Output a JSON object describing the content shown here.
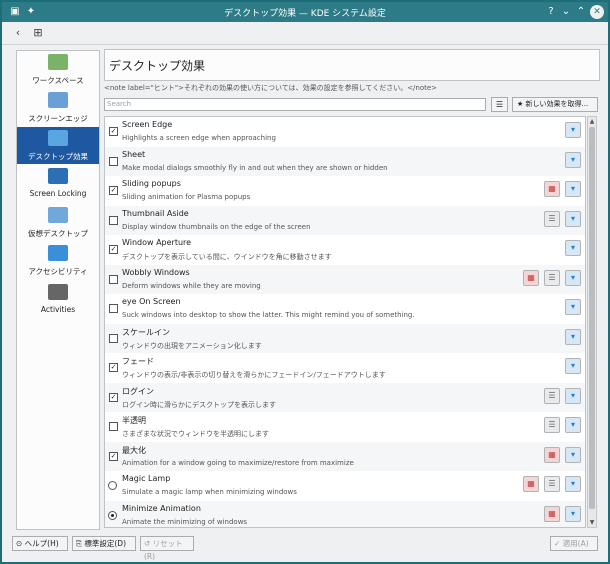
{
  "window": {
    "title": "デスクトップ効果 — KDE システム設定"
  },
  "titlebar": {
    "help_glyph": "?",
    "min_glyph": "⌄",
    "max_glyph": "⌃",
    "close_glyph": "✕"
  },
  "toolbar": {
    "back_glyph": "‹",
    "overview_glyph": "⊞"
  },
  "sidebar": {
    "items": [
      {
        "label": "ワークスペース",
        "icon": "workspace-icon",
        "color": "#7bb26a"
      },
      {
        "label": "スクリーンエッジ",
        "icon": "screen-edge-icon",
        "color": "#6aa0d6"
      },
      {
        "label": "デスクトップ効果",
        "icon": "desktop-effects-icon",
        "color": "#5aa6e0",
        "active": true
      },
      {
        "label": "Screen Locking",
        "icon": "screen-locking-icon",
        "color": "#2b6fb5"
      },
      {
        "label": "仮想デスクトップ",
        "icon": "virtual-desktop-icon",
        "color": "#6fa8d9"
      },
      {
        "label": "アクセシビリティ",
        "icon": "accessibility-icon",
        "color": "#3b8fd8"
      },
      {
        "label": "Activities",
        "icon": "activities-icon",
        "color": "#666666"
      }
    ]
  },
  "content": {
    "title": "デスクトップ効果",
    "note": "<note label=\"ヒント\">それぞれの効果の使い方については、効果の設定を参照してください。</note>",
    "search_placeholder": "Search",
    "config_glyph": "☰",
    "get_new_label": "★ 新しい効果を取得..."
  },
  "effects": [
    {
      "name": "Screen Edge",
      "desc": "Highlights a screen edge when approaching",
      "control": "checkbox",
      "checked": true,
      "video": false,
      "configure": false
    },
    {
      "name": "Sheet",
      "desc": "Make modal dialogs smoothly fly in and out when they are shown or hidden",
      "control": "checkbox",
      "checked": false,
      "video": false,
      "configure": false
    },
    {
      "name": "Sliding popups",
      "desc": "Sliding animation for Plasma popups",
      "control": "checkbox",
      "checked": true,
      "video": true,
      "configure": false
    },
    {
      "name": "Thumbnail Aside",
      "desc": "Display window thumbnails on the edge of the screen",
      "control": "checkbox",
      "checked": false,
      "video": false,
      "configure": true
    },
    {
      "name": "Window Aperture",
      "desc": "デスクトップを表示している間に、ウインドウを角に移動させます",
      "control": "checkbox",
      "checked": true,
      "video": false,
      "configure": false
    },
    {
      "name": "Wobbly Windows",
      "desc": "Deform windows while they are moving",
      "control": "checkbox",
      "checked": false,
      "video": true,
      "configure": true
    },
    {
      "name": "eye On Screen",
      "desc": "Suck windows into desktop to show the latter. This might remind you of something.",
      "control": "checkbox",
      "checked": false,
      "video": false,
      "configure": false
    },
    {
      "name": "スケールイン",
      "desc": "ウィンドウの出現をアニメーション化します",
      "control": "checkbox",
      "checked": false,
      "video": false,
      "configure": false
    },
    {
      "name": "フェード",
      "desc": "ウィンドウの表示/非表示の切り替えを滑らかにフェードイン/フェードアウトします",
      "control": "checkbox",
      "checked": true,
      "video": false,
      "configure": false
    },
    {
      "name": "ログイン",
      "desc": "ログイン時に滑らかにデスクトップを表示します",
      "control": "checkbox",
      "checked": true,
      "video": false,
      "configure": true
    },
    {
      "name": "半透明",
      "desc": "さまざまな状況でウィンドウを半透明にします",
      "control": "checkbox",
      "checked": false,
      "video": false,
      "configure": true
    },
    {
      "name": "最大化",
      "desc": "Animation for a window going to maximize/restore from maximize",
      "control": "checkbox",
      "checked": true,
      "video": true,
      "configure": false
    },
    {
      "name": "Magic Lamp",
      "desc": "Simulate a magic lamp when minimizing windows",
      "control": "radio",
      "checked": false,
      "video": true,
      "configure": true
    },
    {
      "name": "Minimize Animation",
      "desc": "Animate the minimizing of windows",
      "control": "radio",
      "checked": true,
      "video": true,
      "configure": false
    }
  ],
  "glyphs": {
    "check": "✓",
    "info": "▾",
    "video": "▦",
    "configure": "☰",
    "scroll_up": "▲",
    "scroll_down": "▼"
  },
  "bottom": {
    "help_label": "⊙ ヘルプ(H)",
    "defaults_label": "⎘ 標準設定(D)",
    "reset_label": "↺ リセット(R)",
    "apply_label": "✓ 適用(A)"
  }
}
